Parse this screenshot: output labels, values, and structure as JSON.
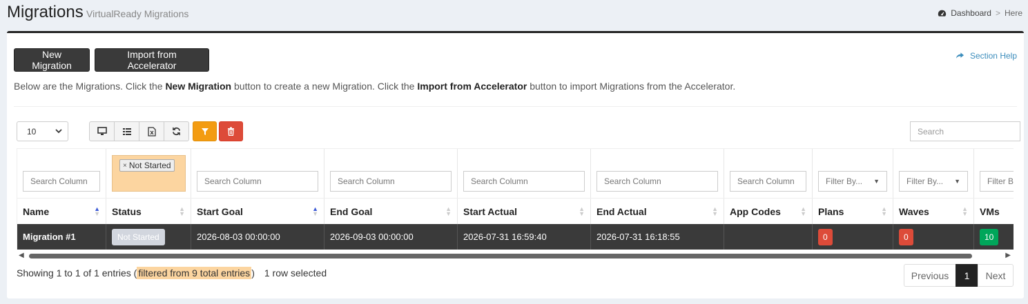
{
  "header": {
    "title": "Migrations",
    "subtitle": "VirtualReady Migrations",
    "breadcrumb": {
      "dashboard": "Dashboard",
      "separator": ">",
      "here": "Here"
    }
  },
  "toolbar": {
    "new_migration": "New Migration",
    "import_accelerator": "Import from Accelerator",
    "section_help": "Section Help"
  },
  "intro": {
    "part1": "Below are the Migrations. Click the ",
    "bold1": "New Migration",
    "part2": " button to create a new Migration. Click the ",
    "bold2": "Import from Accelerator",
    "part3": " button to import Migrations from the Accelerator."
  },
  "table_controls": {
    "page_length": "10",
    "search_placeholder": "Search",
    "accent_orange": "#f39c12",
    "accent_red": "#dd4b39"
  },
  "filters": {
    "search_column": "Search Column",
    "filter_by": "Filter By...",
    "filter_by_cut": "Filter B",
    "status_chip": "Not Started",
    "status_chip_remove": "×"
  },
  "columns": [
    "Name",
    "Status",
    "Start Goal",
    "End Goal",
    "Start Actual",
    "End Actual",
    "App Codes",
    "Plans",
    "Waves",
    "VMs"
  ],
  "rows": [
    {
      "name": "Migration #1",
      "status": "Not Started",
      "start_goal": "2026-08-03 00:00:00",
      "end_goal": "2026-09-03 00:00:00",
      "start_actual": "2026-07-31 16:59:40",
      "end_actual": "2026-07-31 16:18:55",
      "app_codes": "",
      "plans": "0",
      "waves": "0",
      "vms": "10"
    }
  ],
  "footer": {
    "showing": "Showing 1 to 1 of 1 entries (",
    "filtered": "filtered from 9 total entries",
    "close_paren": ")",
    "selected": "1 row selected",
    "prev": "Previous",
    "page": "1",
    "next": "Next"
  }
}
